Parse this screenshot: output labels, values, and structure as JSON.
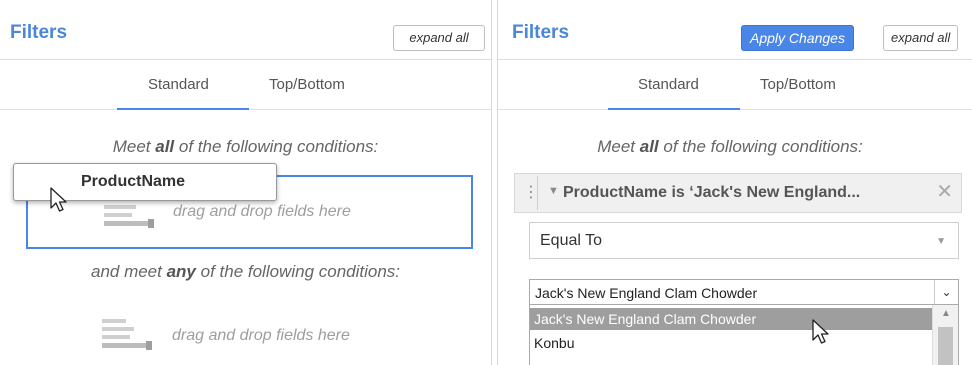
{
  "left": {
    "title": "Filters",
    "expand_label": "expand all",
    "tabs": [
      "Standard",
      "Top/Bottom"
    ],
    "cond_all_pre": "Meet ",
    "cond_all_word": "all",
    "cond_all_post": " of the following conditions:",
    "drag_chip_label": "ProductName",
    "drop_hint_1": "drag and drop fields here",
    "cond_any_pre": "and meet ",
    "cond_any_word": "any",
    "cond_any_post": " of the following conditions:",
    "drop_hint_2": "drag and drop fields here"
  },
  "right": {
    "title": "Filters",
    "apply_label": "Apply Changes",
    "expand_label": "expand all",
    "tabs": [
      "Standard",
      "Top/Bottom"
    ],
    "cond_all_pre": "Meet ",
    "cond_all_word": "all",
    "cond_all_post": " of the following conditions:",
    "filter_label": "ProductName is ‘Jack's New England...",
    "operator": "Equal To",
    "value_selected": "Jack's New England Clam Chowder",
    "options": [
      "Jack's New England Clam Chowder",
      "Konbu"
    ]
  },
  "colors": {
    "accent": "#4a86e8",
    "title": "#4b86d8",
    "selected_row": "#9e9e9e"
  },
  "icons": {
    "grip": "vertical-dots-icon",
    "caret": "triangle-down-icon",
    "close": "close-x-icon",
    "fields": "fields-list-icon",
    "cursor": "arrow-cursor-icon"
  }
}
